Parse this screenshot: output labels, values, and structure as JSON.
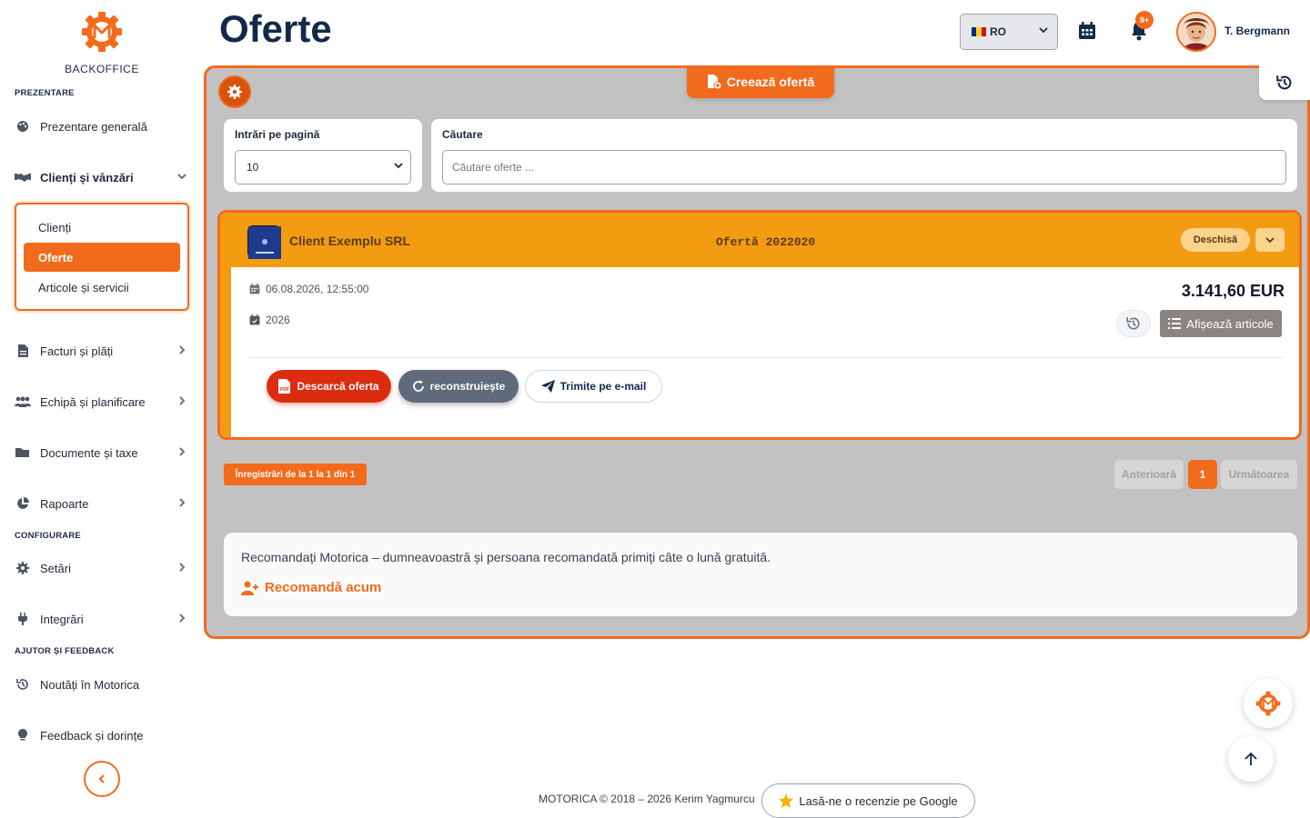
{
  "brand": {
    "name": "BACKOFFICE",
    "accent": "#f26b1d",
    "navy": "#13294b"
  },
  "sidebar": {
    "sections": {
      "presentation": "PREZENTARE",
      "configuration": "CONFIGURARE",
      "help": "AJUTOR ȘI FEEDBACK"
    },
    "items": {
      "overview": {
        "label": "Prezentare generală",
        "icon": "palette-icon"
      },
      "clients_sales": {
        "label": "Clienți și vânzări",
        "icon": "handshake-icon"
      },
      "invoices": {
        "label": "Facturi și plăți",
        "icon": "invoice-icon"
      },
      "team": {
        "label": "Echipă și planificare",
        "icon": "users-icon"
      },
      "documents": {
        "label": "Documente și taxe",
        "icon": "folder-icon"
      },
      "reports": {
        "label": "Rapoarte",
        "icon": "pie-chart-icon"
      },
      "settings": {
        "label": "Setări",
        "icon": "gear-icon"
      },
      "integrations": {
        "label": "Integrări",
        "icon": "plug-icon"
      },
      "news": {
        "label": "Noutăți în Motorica",
        "icon": "history-icon"
      },
      "feedback": {
        "label": "Feedback și dorințe",
        "icon": "lightbulb-icon"
      }
    },
    "submenu": {
      "clients": "Clienți",
      "offers": "Oferte",
      "articles": "Articole și servicii"
    }
  },
  "header": {
    "title": "Oferte",
    "language": "RO",
    "notifications_badge": "9+",
    "user_name": "T. Bergmann"
  },
  "toolbar": {
    "create_label": "Creează ofertă"
  },
  "filters": {
    "per_page_label": "Intrări pe pagină",
    "per_page_value": "10",
    "search_label": "Căutare",
    "search_placeholder": "Căutare oferte ..."
  },
  "offer": {
    "client": "Client Exemplu SRL",
    "number": "Ofertă 2022020",
    "status": "Deschisă",
    "datetime": "06.08.2026, 12:55:00",
    "year": "2026",
    "amount": "3.141,60 EUR",
    "show_items_label": "Afișează articole",
    "download_label": "Descarcă oferta",
    "rebuild_label": "reconstruiește",
    "email_label": "Trimite pe e-mail"
  },
  "pagination": {
    "records": "Înregistrări de la 1 la 1 din 1",
    "prev": "Anterioară",
    "page": "1",
    "next": "Următoarea"
  },
  "referral": {
    "text": "Recomandați Motorica – dumneavoastră și persoana recomandată primiți câte o lună gratuită.",
    "link": "Recomandă acum"
  },
  "footer": {
    "copyright": "MOTORICA © 2018 – 2026 Kerim Yagmurcu",
    "review_label": "Lasă-ne o recenzie pe Google"
  }
}
